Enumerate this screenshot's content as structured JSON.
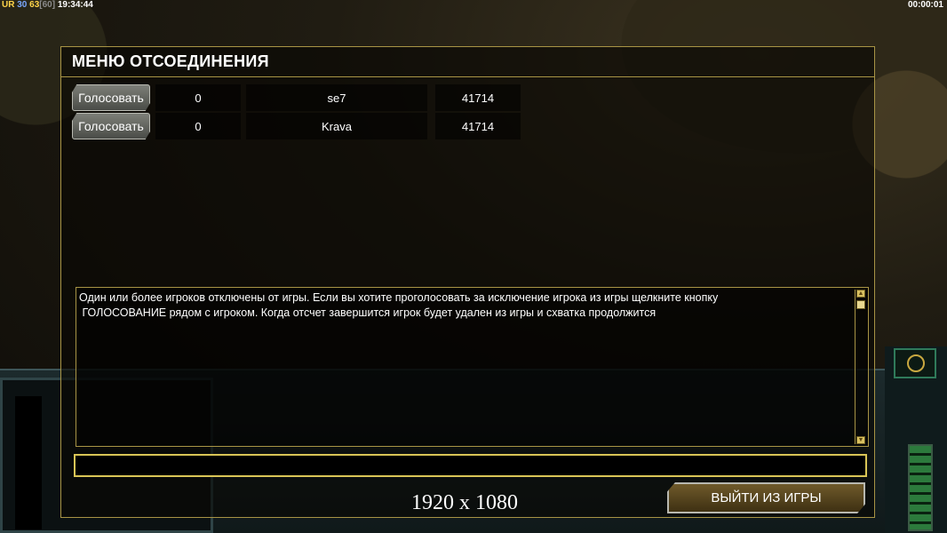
{
  "hud": {
    "left_a": "UR",
    "left_b": "30",
    "left_c": "63",
    "left_d": "[60]",
    "left_time": "19:34:44",
    "right_time": "00:00:01"
  },
  "dialog": {
    "title": "МЕНЮ ОТСОЕДИНЕНИЯ",
    "rows": [
      {
        "vote_label": "Голосовать",
        "votes": "0",
        "player": "se7",
        "ping": "41714"
      },
      {
        "vote_label": "Голосовать",
        "votes": "0",
        "player": "Krava",
        "ping": "41714"
      }
    ],
    "message": "Один или более игроков отключены от игры. Если вы хотите проголосовать за исключение игрока из игры щелкните кнопку\n ГОЛОСОВАНИЕ рядом с игроком. Когда отсчет завершится игрок будет удален из игры и схватка продолжится",
    "chat_value": "",
    "exit_label": "ВЫЙТИ ИЗ ИГРЫ"
  },
  "overlay": {
    "resolution": "1920 x 1080"
  },
  "colors": {
    "gold_border": "#a89445",
    "input_border": "#d9c556"
  }
}
